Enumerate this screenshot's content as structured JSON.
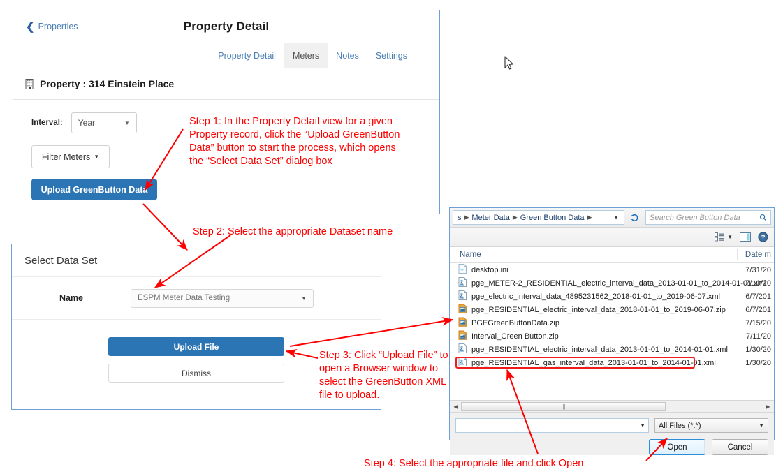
{
  "property_detail": {
    "back_link": "Properties",
    "title": "Property Detail",
    "tabs": [
      {
        "label": "Property Detail",
        "active": false
      },
      {
        "label": "Meters",
        "active": true
      },
      {
        "label": "Notes",
        "active": false
      },
      {
        "label": "Settings",
        "active": false
      }
    ],
    "subject": "Property : 314 Einstein Place",
    "interval_label": "Interval:",
    "interval_value": "Year",
    "filter_meters_label": "Filter Meters",
    "upload_button_label": "Upload GreenButton Data"
  },
  "dataset_dialog": {
    "title": "Select Data Set",
    "name_label": "Name",
    "name_value": "ESPM Meter Data Testing",
    "upload_file_label": "Upload File",
    "dismiss_label": "Dismiss"
  },
  "file_dialog": {
    "breadcrumb": [
      "s",
      "Meter Data",
      "Green Button Data"
    ],
    "search_placeholder": "Search Green Button Data",
    "column_name": "Name",
    "column_date": "Date m",
    "files": [
      {
        "name": "desktop.ini",
        "date": "7/31/20",
        "icon": "ini-file-icon",
        "selected": false
      },
      {
        "name": "pge_METER-2_RESIDENTIAL_electric_interval_data_2013-01-01_to_2014-01-01.xml",
        "date": "7/10/20",
        "icon": "xml-file-icon",
        "selected": false
      },
      {
        "name": "pge_electric_interval_data_4895231562_2018-01-01_to_2019-06-07.xml",
        "date": "6/7/201",
        "icon": "xml-file-icon",
        "selected": false
      },
      {
        "name": "pge_RESIDENTIAL_electric_interval_data_2018-01-01_to_2019-06-07.zip",
        "date": "6/7/201",
        "icon": "zip-file-icon",
        "selected": false
      },
      {
        "name": "PGEGreenButtonData.zip",
        "date": "7/15/20",
        "icon": "zip-file-icon",
        "selected": false
      },
      {
        "name": "Interval_Green Button.zip",
        "date": "7/11/20",
        "icon": "zip-file-icon",
        "selected": false
      },
      {
        "name": "pge_RESIDENTIAL_electric_interval_data_2013-01-01_to_2014-01-01.xml",
        "date": "1/30/20",
        "icon": "xml-file-icon",
        "selected": false
      },
      {
        "name": "pge_RESIDENTIAL_gas_interval_data_2013-01-01_to_2014-01-01.xml",
        "date": "1/30/20",
        "icon": "xml-file-icon",
        "selected": true
      }
    ],
    "filename_value": "",
    "filetype_value": "All Files (*.*)",
    "open_label": "Open",
    "cancel_label": "Cancel"
  },
  "annotations": {
    "step1": "Step 1: In the Property Detail view for a given Property record, click the “Upload GreenButton Data” button to start the process, which opens the “Select Data Set” dialog box",
    "step2": "Step 2: Select the appropriate Dataset name",
    "step3": "Step 3: Click “Upload File” to open a Browser window to select the GreenButton XML file to upload.",
    "step4": "Step 4: Select the appropriate file and click Open"
  },
  "colors": {
    "accent_blue": "#2c75b5",
    "panel_border": "#6f9fd8",
    "annotation_red": "#ff0000",
    "link_blue": "#4a7fb5"
  }
}
